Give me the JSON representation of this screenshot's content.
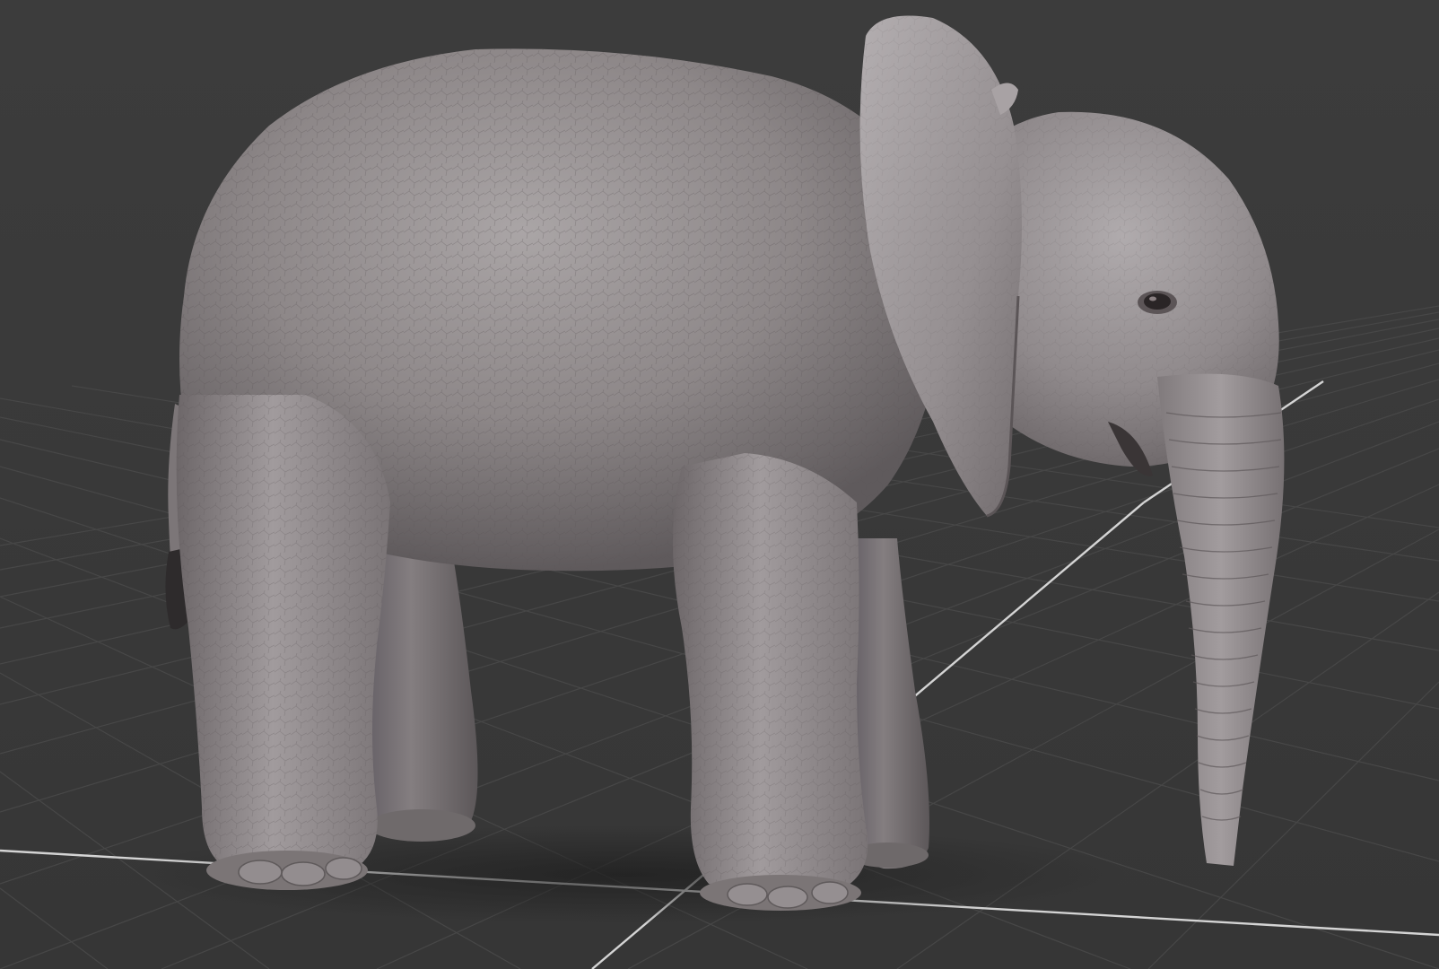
{
  "viewport": {
    "background": "#3a3a3a",
    "grid_color": "#474747",
    "axis_color": "#d9d9d9",
    "model_name": "elephant-model",
    "model_color": "#8c8687"
  }
}
